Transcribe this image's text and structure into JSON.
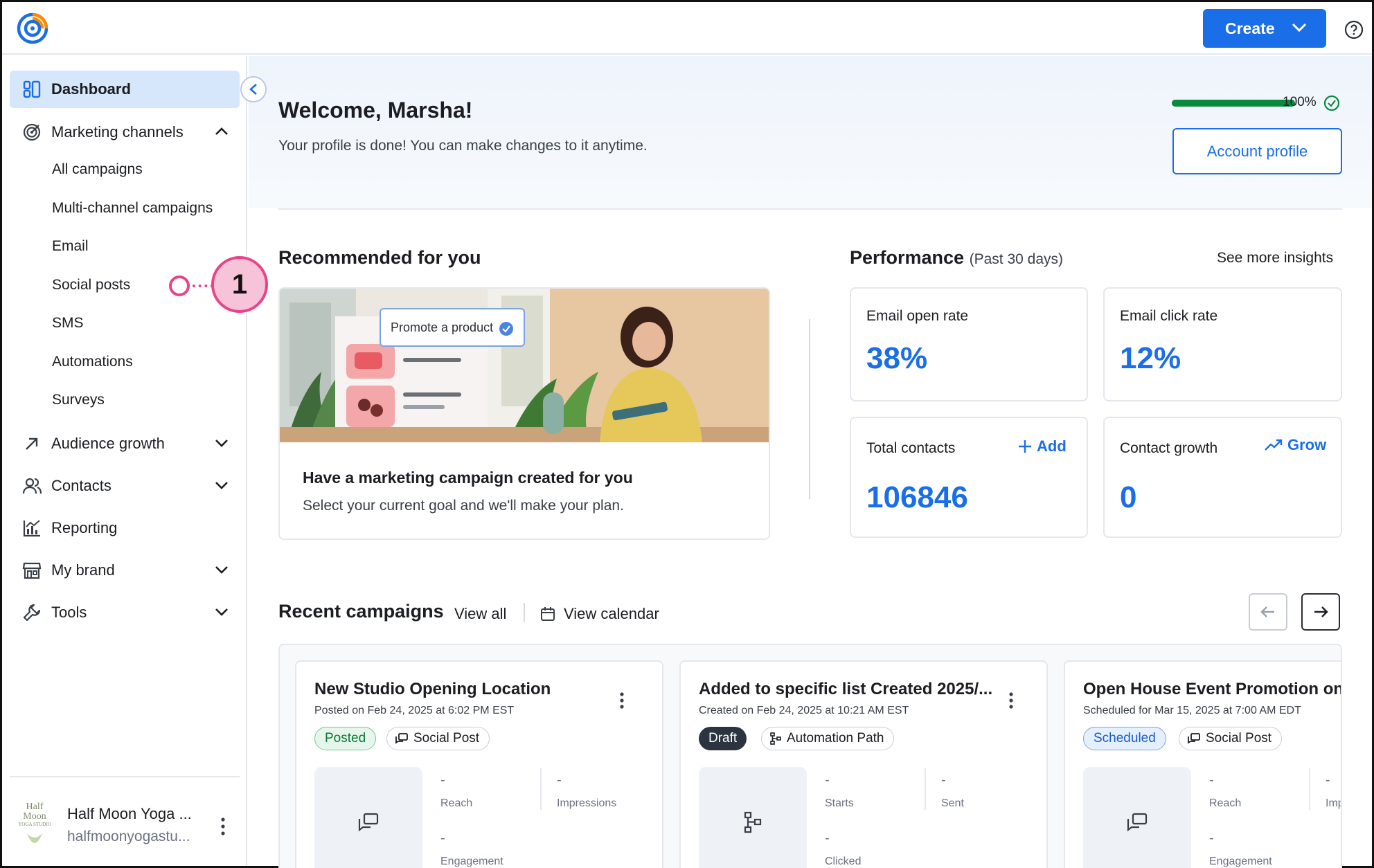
{
  "header": {
    "create_label": "Create",
    "logo_icon": "constant-contact-logo-icon",
    "help_icon": "help-circle-icon"
  },
  "sidebar": {
    "items": [
      {
        "label": "Dashboard",
        "icon": "dashboard-icon",
        "active": true
      },
      {
        "label": "Marketing channels",
        "icon": "target-icon",
        "expanded": true
      },
      {
        "label": "Audience growth",
        "icon": "arrow-up-right-icon"
      },
      {
        "label": "Contacts",
        "icon": "people-icon"
      },
      {
        "label": "Reporting",
        "icon": "chart-icon"
      },
      {
        "label": "My brand",
        "icon": "storefront-icon"
      },
      {
        "label": "Tools",
        "icon": "wrench-icon"
      }
    ],
    "sub_items": [
      "All campaigns",
      "Multi-channel campaigns",
      "Email",
      "Social posts",
      "SMS",
      "Automations",
      "Surveys"
    ],
    "account": {
      "name": "Half Moon Yoga ...",
      "email": "halfmoonyogastu...",
      "logo_text": "Half Moon",
      "logo_subtext": "YOGA STUDIO"
    }
  },
  "callout": {
    "number": "1",
    "color": "#e9448a"
  },
  "welcome": {
    "title": "Welcome, Marsha!",
    "subtitle": "Your profile is done! You can make changes to it anytime.",
    "progress_percent": 100,
    "progress_label": "100%",
    "account_profile_label": "Account profile"
  },
  "recommended": {
    "title": "Recommended for you",
    "chip_label": "Promote a product",
    "card_title": "Have a marketing campaign created for you",
    "card_subtitle": "Select your current goal and we'll make your plan."
  },
  "performance": {
    "title": "Performance",
    "period": "(Past 30 days)",
    "see_more": "See more insights",
    "metrics": [
      {
        "label": "Email open rate",
        "value": "38%"
      },
      {
        "label": "Email click rate",
        "value": "12%"
      },
      {
        "label": "Total contacts",
        "value": "106846",
        "action": "Add"
      },
      {
        "label": "Contact growth",
        "value": "0",
        "action": "Grow"
      }
    ]
  },
  "recent": {
    "title": "Recent campaigns",
    "view_all": "View all",
    "view_calendar": "View calendar",
    "campaigns": [
      {
        "title": "New Studio Opening Location",
        "date": "Posted on Feb 24, 2025 at 6:02 PM EST",
        "status": "Posted",
        "type": "Social Post",
        "stats": [
          {
            "value": "-",
            "label": "Reach"
          },
          {
            "value": "-",
            "label": "Impressions"
          },
          {
            "value": "-",
            "label": "Engagement"
          }
        ]
      },
      {
        "title": "Added to specific list Created 2025/...",
        "date": "Created on Feb 24, 2025 at 10:21 AM EST",
        "status": "Draft",
        "type": "Automation Path",
        "stats": [
          {
            "value": "-",
            "label": "Starts"
          },
          {
            "value": "-",
            "label": "Sent"
          },
          {
            "value": "-",
            "label": "Clicked"
          }
        ]
      },
      {
        "title": "Open House Event Promotion on",
        "date": "Scheduled for Mar 15, 2025 at 7:00 AM EDT",
        "status": "Scheduled",
        "type": "Social Post",
        "stats": [
          {
            "value": "-",
            "label": "Reach"
          },
          {
            "value": "-",
            "label": "Imp"
          },
          {
            "value": "-",
            "label": "Engagement"
          }
        ]
      }
    ]
  },
  "colors": {
    "accent": "#1a6ee8",
    "success": "#0a8a3d",
    "callout": "#e9448a"
  }
}
